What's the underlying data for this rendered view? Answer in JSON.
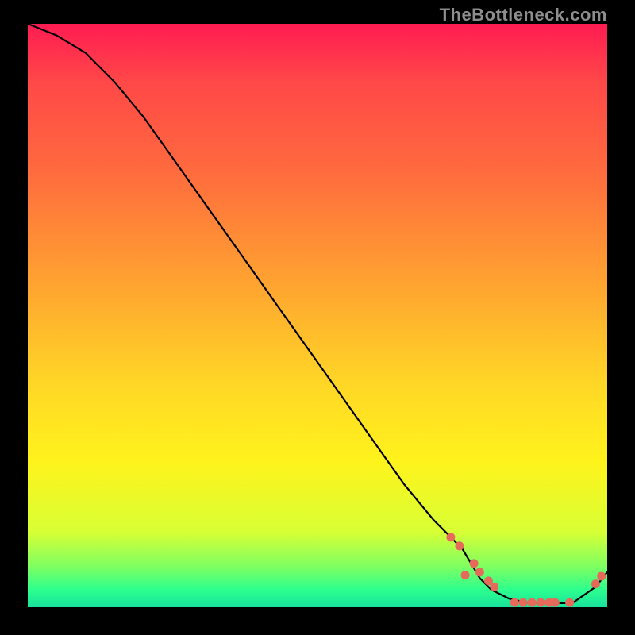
{
  "watermark": "TheBottleneck.com",
  "chart_data": {
    "type": "line",
    "title": "",
    "xlabel": "",
    "ylabel": "",
    "xlim": [
      0,
      100
    ],
    "ylim": [
      0,
      100
    ],
    "grid": false,
    "legend": false,
    "series": [
      {
        "name": "curve",
        "x": [
          0,
          5,
          10,
          15,
          20,
          25,
          30,
          35,
          40,
          45,
          50,
          55,
          60,
          65,
          70,
          75,
          78,
          80,
          83,
          86,
          90,
          94,
          98,
          100
        ],
        "y": [
          100,
          98,
          95,
          90,
          84,
          77,
          70,
          63,
          56,
          49,
          42,
          35,
          28,
          21,
          15,
          10,
          5,
          3,
          1.5,
          0.8,
          0.7,
          0.7,
          3.5,
          6
        ]
      }
    ],
    "markers": [
      {
        "x": 73.0,
        "y": 12.0
      },
      {
        "x": 74.5,
        "y": 10.5
      },
      {
        "x": 75.5,
        "y": 5.5
      },
      {
        "x": 77.0,
        "y": 7.5
      },
      {
        "x": 78.0,
        "y": 6.0
      },
      {
        "x": 79.5,
        "y": 4.5
      },
      {
        "x": 80.5,
        "y": 3.5
      },
      {
        "x": 84.0,
        "y": 0.8
      },
      {
        "x": 85.5,
        "y": 0.8
      },
      {
        "x": 87.0,
        "y": 0.8
      },
      {
        "x": 88.5,
        "y": 0.8
      },
      {
        "x": 90.0,
        "y": 0.8
      },
      {
        "x": 91.0,
        "y": 0.8
      },
      {
        "x": 93.5,
        "y": 0.8
      },
      {
        "x": 98.0,
        "y": 4.0
      },
      {
        "x": 99.0,
        "y": 5.3
      }
    ]
  }
}
